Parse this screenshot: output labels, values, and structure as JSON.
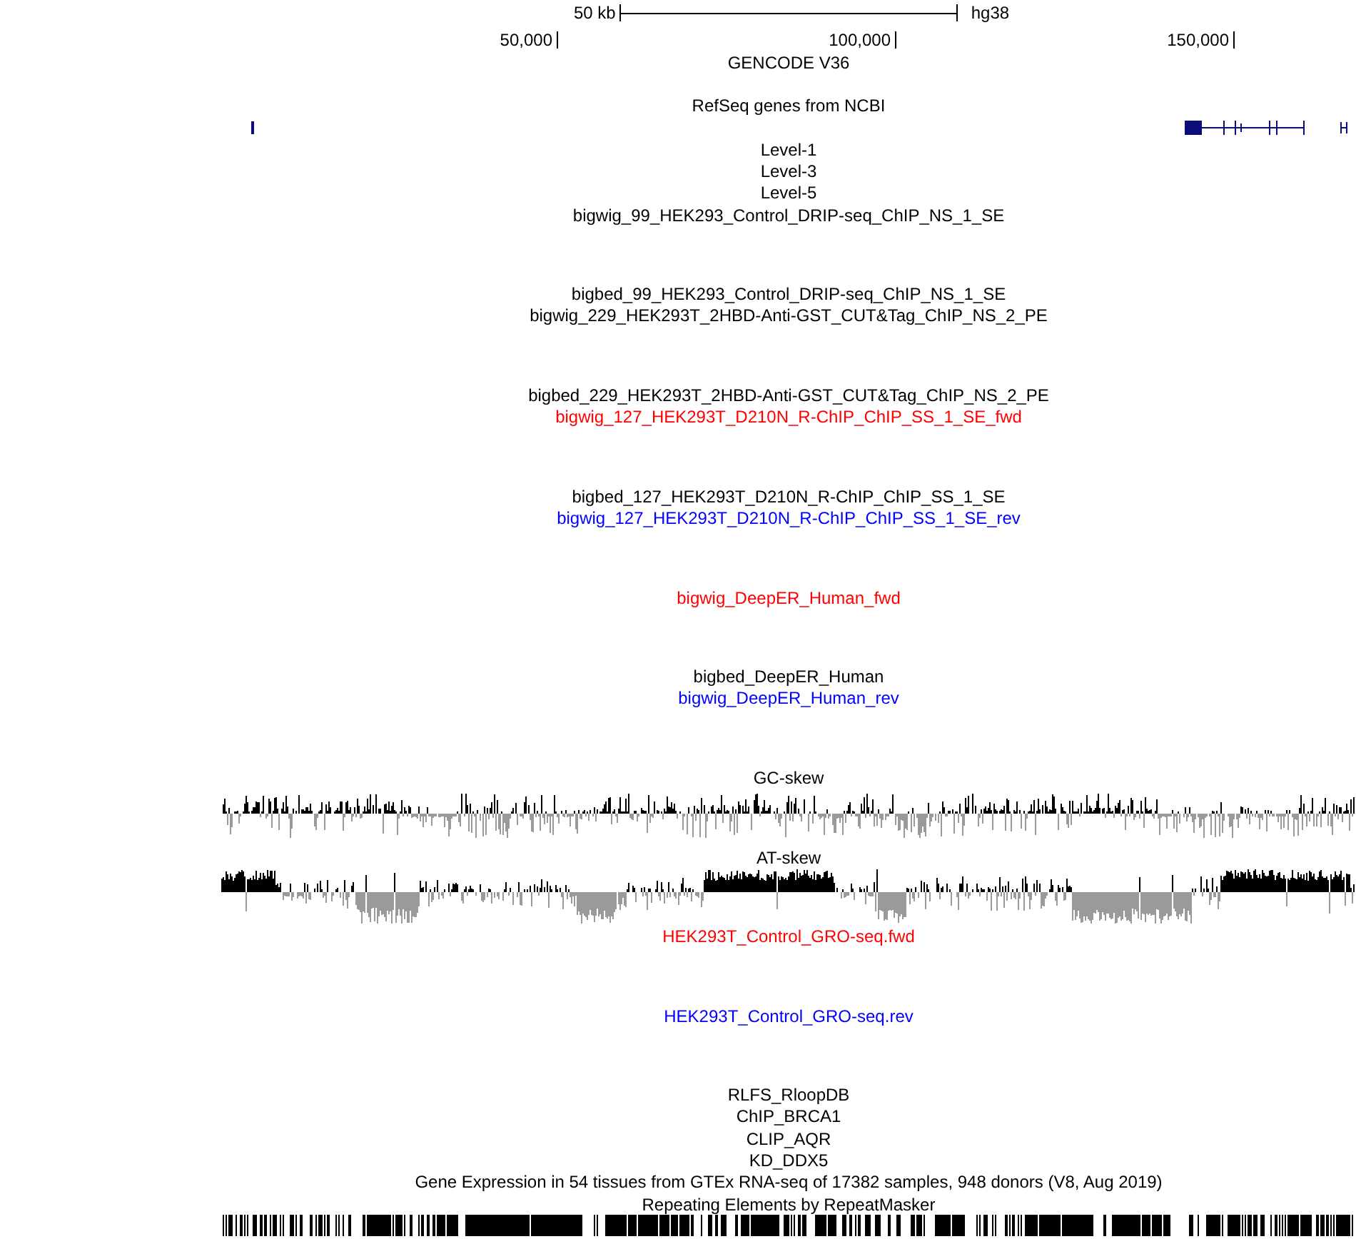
{
  "scale_bar": {
    "span": "50 kb",
    "assembly": "hg38"
  },
  "ruler": {
    "ticks": [
      "50,000",
      "100,000",
      "150,000"
    ]
  },
  "tracks": [
    {
      "label": "GENCODE V36",
      "kind": "bed",
      "color": "#000000"
    },
    {
      "label": "RefSeq genes from NCBI",
      "kind": "genes",
      "color": "#000000"
    },
    {
      "label": "Level-1",
      "kind": "plain",
      "color": "#000000"
    },
    {
      "label": "Level-3",
      "kind": "plain",
      "color": "#000000"
    },
    {
      "label": "Level-5",
      "kind": "plain",
      "color": "#000000"
    },
    {
      "label": "bigwig_99_HEK293_Control_DRIP-seq_ChIP_NS_1_SE",
      "kind": "wiggle",
      "color": "#000000"
    },
    {
      "label": "bigbed_99_HEK293_Control_DRIP-seq_ChIP_NS_1_SE",
      "kind": "plain",
      "color": "#000000"
    },
    {
      "label": "bigwig_229_HEK293T_2HBD-Anti-GST_CUT&Tag_ChIP_NS_2_PE",
      "kind": "wiggle",
      "color": "#000000"
    },
    {
      "label": "bigbed_229_HEK293T_2HBD-Anti-GST_CUT&Tag_ChIP_NS_2_PE",
      "kind": "plain",
      "color": "#000000"
    },
    {
      "label": "bigwig_127_HEK293T_D210N_R-ChIP_ChIP_SS_1_SE_fwd",
      "kind": "wiggle",
      "color": "#ff0000"
    },
    {
      "label": "bigbed_127_HEK293T_D210N_R-ChIP_ChIP_SS_1_SE",
      "kind": "plain",
      "color": "#000000"
    },
    {
      "label": "bigwig_127_HEK293T_D210N_R-ChIP_ChIP_SS_1_SE_rev",
      "kind": "wiggle",
      "color": "#0000ff"
    },
    {
      "label": "bigwig_DeepER_Human_fwd",
      "kind": "wiggle",
      "color": "#ff0000"
    },
    {
      "label": "bigbed_DeepER_Human",
      "kind": "plain",
      "color": "#000000"
    },
    {
      "label": "bigwig_DeepER_Human_rev",
      "kind": "wiggle",
      "color": "#0000ff"
    },
    {
      "label": "GC-skew",
      "kind": "skew",
      "color": "#000000"
    },
    {
      "label": "AT-skew",
      "kind": "skew",
      "color": "#000000"
    },
    {
      "label": "HEK293T_Control_GRO-seq.fwd",
      "kind": "wiggle",
      "color": "#ff0000"
    },
    {
      "label": "HEK293T_Control_GRO-seq.rev",
      "kind": "wiggle",
      "color": "#0000ff"
    },
    {
      "label": "RLFS_RloopDB",
      "kind": "plain",
      "color": "#000000"
    },
    {
      "label": "ChIP_BRCA1",
      "kind": "plain",
      "color": "#000000"
    },
    {
      "label": "CLIP_AQR",
      "kind": "plain",
      "color": "#000000"
    },
    {
      "label": "KD_DDX5",
      "kind": "plain",
      "color": "#000000"
    },
    {
      "label": "Gene Expression in 54 tissues from GTEx RNA-seq of 17382 samples, 948 donors (V8, Aug 2019)",
      "kind": "plain",
      "color": "#000000"
    },
    {
      "label": "Repeating Elements by RepeatMasker",
      "kind": "repeats",
      "color": "#000000"
    }
  ]
}
